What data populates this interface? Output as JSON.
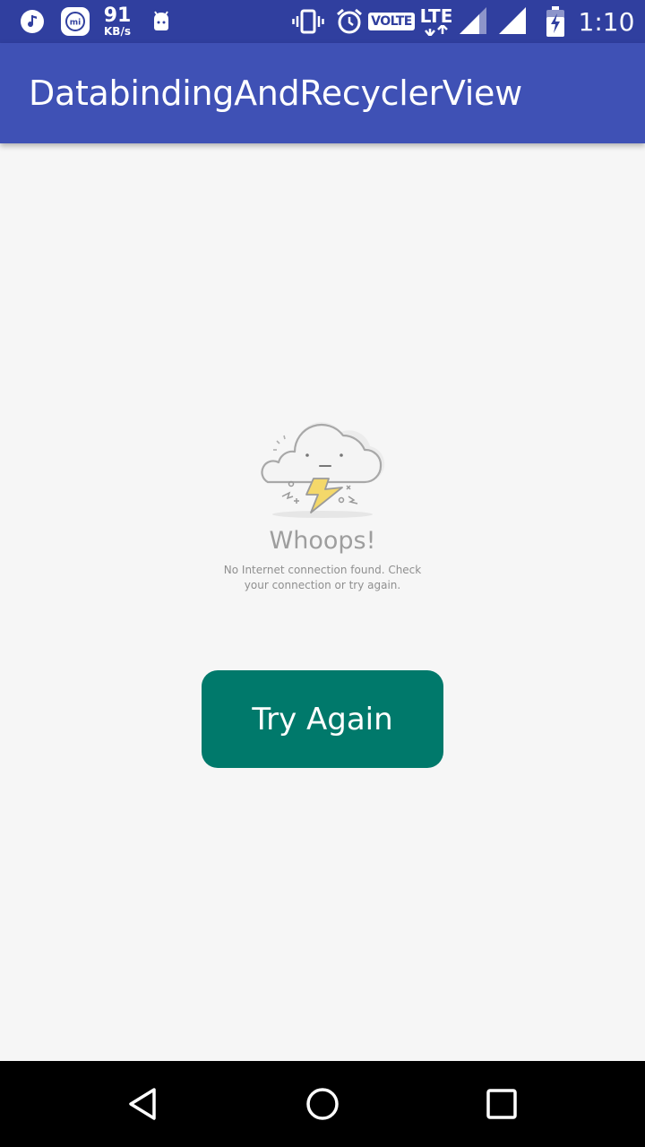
{
  "status_bar": {
    "net_speed_value": "91",
    "net_speed_unit": "KB/s",
    "volte_label": "VOLTE",
    "lte_label": "LTE",
    "time": "1:10",
    "icons": [
      "music-icon",
      "mi-icon",
      "android-icon",
      "vibrate-icon",
      "alarm-icon",
      "signal-icon",
      "battery-charging-icon"
    ]
  },
  "app_bar": {
    "title": "DatabindingAndRecyclerView"
  },
  "error": {
    "title": "Whoops!",
    "message_line1": "No Internet connection found. Check",
    "message_line2": "your connection or try again.",
    "illustration_icon": "storm-cloud-icon"
  },
  "actions": {
    "try_again_label": "Try Again"
  },
  "nav_bar": {
    "icons": [
      "back-icon",
      "home-icon",
      "recents-icon"
    ]
  },
  "colors": {
    "status_bar": "#303f9f",
    "app_bar": "#3f51b5",
    "button": "#00796b",
    "background": "#f6f6f6"
  }
}
